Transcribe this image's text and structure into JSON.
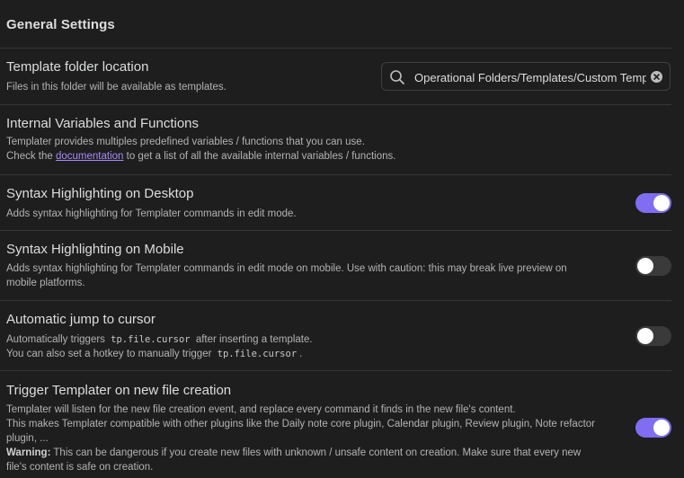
{
  "section": {
    "title": "General Settings"
  },
  "template_folder": {
    "name": "Template folder location",
    "desc": "Files in this folder will be available as templates.",
    "search": {
      "icon": "search-icon",
      "value": "Operational Folders/Templates/Custom Templates",
      "clear_icon": "clear-icon"
    }
  },
  "internal_vars": {
    "name": "Internal Variables and Functions",
    "desc_line1": "Templater provides multiples predefined variables / functions that you can use.",
    "desc_pre": "Check the ",
    "link": "documentation",
    "desc_post": " to get a list of all the available internal variables / functions."
  },
  "syntax_desktop": {
    "name": "Syntax Highlighting on Desktop",
    "desc": "Adds syntax highlighting for Templater commands in edit mode.",
    "enabled": true
  },
  "syntax_mobile": {
    "name": "Syntax Highlighting on Mobile",
    "desc_line1": "Adds syntax highlighting for Templater commands in edit mode on mobile. Use with caution: this may break live preview on",
    "desc_line2": "mobile platforms.",
    "enabled": false
  },
  "auto_jump": {
    "name": "Automatic jump to cursor",
    "desc1_pre": "Automatically triggers ",
    "code": "tp.file.cursor",
    "desc1_post": " after inserting a template.",
    "desc2_pre": "You can also set a hotkey to manually trigger ",
    "desc2_post": ".",
    "enabled": false
  },
  "trigger_new_file": {
    "name": "Trigger Templater on new file creation",
    "desc_line1": "Templater will listen for the new file creation event, and replace every command it finds in the new file's content.",
    "desc_line2": "This makes Templater compatible with other plugins like the Daily note core plugin, Calendar plugin, Review plugin, Note refactor",
    "desc_line3": "plugin, ...",
    "warning_label": "Warning:",
    "warning_text": " This can be dangerous if you create new files with unknown / unsafe content on creation. Make sure that every new",
    "desc_line5": "file's content is safe on creation.",
    "enabled": true
  },
  "colors": {
    "accent": "#7f6df2",
    "link": "#a88bfa",
    "background": "#1e1e1e",
    "toggle_off": "#3a3a3a"
  }
}
